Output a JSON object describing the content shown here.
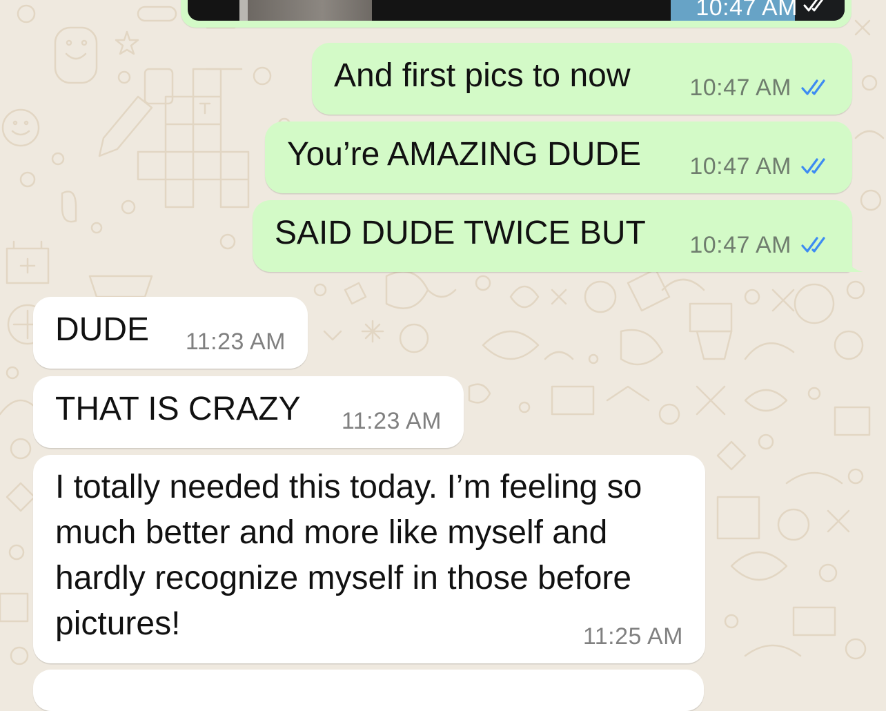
{
  "theme": {
    "wallpaper": "#efe9df",
    "outgoing_bubble": "#d3fac7",
    "incoming_bubble": "#ffffff",
    "read_tick": "#3d8bf2"
  },
  "conversation": {
    "image_message": {
      "time": "10:47 AM",
      "status": "read"
    },
    "outgoing": [
      {
        "text": "And first pics to now",
        "time": "10:47 AM",
        "status": "read"
      },
      {
        "text": "You’re AMAZING DUDE",
        "time": "10:47 AM",
        "status": "read"
      },
      {
        "text": "SAID DUDE TWICE BUT",
        "time": "10:47 AM",
        "status": "read"
      }
    ],
    "incoming": [
      {
        "text": "DUDE",
        "time": "11:23 AM"
      },
      {
        "text": "THAT IS CRAZY",
        "time": "11:23 AM"
      },
      {
        "text": "I totally needed this today. I’m feeling so much better and more like myself and hardly recognize myself in those before pictures!",
        "time": "11:25 AM"
      }
    ]
  },
  "icons": {
    "read_receipt": "double-check-icon"
  }
}
